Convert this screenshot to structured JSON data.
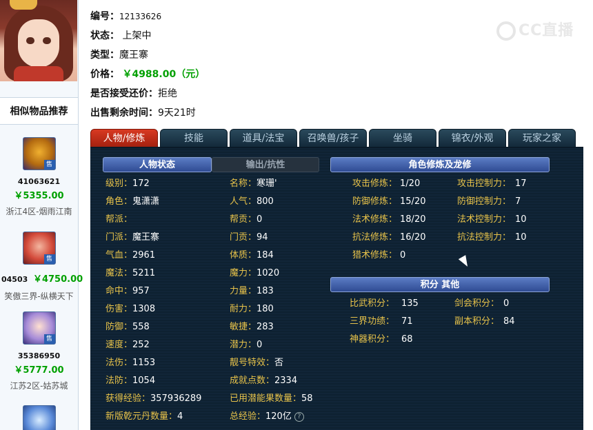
{
  "item": {
    "id_label": "编号：",
    "id": "12133626",
    "status_label": "状态：",
    "status": "上架中",
    "type_label": "类型：",
    "type": "魔王寨",
    "price_label": "价格：",
    "price": "￥4988.00（元）",
    "bargain_label": "是否接受还价：",
    "bargain": "拒绝",
    "remaining_label": "出售剩余时间：",
    "remaining": "9天21时"
  },
  "watermark": "CC直播",
  "sidebar": {
    "similar_title": "相似物品推荐",
    "recommendations": [
      {
        "id": "41063621",
        "price": "￥5355.00",
        "server": "浙江4区-烟雨江南",
        "badge": "售"
      },
      {
        "id": "04503",
        "price": "￥4750.00",
        "server": "笑傲三界-纵横天下",
        "badge": "售"
      },
      {
        "id": "35386950",
        "price": "￥5777.00",
        "server": "江苏2区-姑苏城",
        "badge": "售"
      }
    ]
  },
  "tabs": [
    "人物/修炼",
    "技能",
    "道具/法宝",
    "召唤兽/孩子",
    "坐骑",
    "锦衣/外观",
    "玩家之家"
  ],
  "panel": {
    "status_tab": "人物状态",
    "output_tab": "输出/抗性",
    "cultivation_title": "角色修炼及龙修",
    "score_title": "积分 其他",
    "left_col": [
      {
        "k": "级别：",
        "v": "172"
      },
      {
        "k": "角色：",
        "v": "鬼潇潇"
      },
      {
        "k": "帮派：",
        "v": ""
      },
      {
        "k": "门派：",
        "v": "魔王寨"
      },
      {
        "k": "气血：",
        "v": "2961"
      },
      {
        "k": "魔法：",
        "v": "5211"
      },
      {
        "k": "命中：",
        "v": "957"
      },
      {
        "k": "伤害：",
        "v": "1308"
      },
      {
        "k": "防御：",
        "v": "558"
      },
      {
        "k": "速度：",
        "v": "252"
      },
      {
        "k": "法伤：",
        "v": "1153"
      },
      {
        "k": "法防：",
        "v": "1054"
      },
      {
        "k": "获得经验：",
        "v": "357936289"
      },
      {
        "k": "新版乾元丹数量：",
        "v": "4"
      }
    ],
    "mid_col": [
      {
        "k": "名称：",
        "v": "寒珊'"
      },
      {
        "k": "人气：",
        "v": "800"
      },
      {
        "k": "帮贡：",
        "v": "0"
      },
      {
        "k": "门贡：",
        "v": "94"
      },
      {
        "k": "体质：",
        "v": "184"
      },
      {
        "k": "魔力：",
        "v": "1020"
      },
      {
        "k": "力量：",
        "v": "183"
      },
      {
        "k": "耐力：",
        "v": "180"
      },
      {
        "k": "敏捷：",
        "v": "283"
      },
      {
        "k": "潜力：",
        "v": "0"
      },
      {
        "k": "靓号特效：",
        "v": "否"
      },
      {
        "k": "成就点数：",
        "v": "2334"
      },
      {
        "k": "已用潜能果数量：",
        "v": "58"
      },
      {
        "k": "总经验：",
        "v": "120亿"
      }
    ],
    "cult_col1": [
      {
        "k": "攻击修炼：",
        "v": "1/20"
      },
      {
        "k": "防御修炼：",
        "v": "15/20"
      },
      {
        "k": "法术修炼：",
        "v": "18/20"
      },
      {
        "k": "抗法修炼：",
        "v": "16/20"
      },
      {
        "k": "猎术修炼：",
        "v": "0"
      }
    ],
    "cult_col2": [
      {
        "k": "攻击控制力：",
        "v": "17"
      },
      {
        "k": "防御控制力：",
        "v": "7"
      },
      {
        "k": "法术控制力：",
        "v": "10"
      },
      {
        "k": "抗法控制力：",
        "v": "10"
      }
    ],
    "score_col1": [
      {
        "k": "比武积分：",
        "v": "135"
      },
      {
        "k": "三界功绩：",
        "v": "71"
      },
      {
        "k": "神器积分：",
        "v": "68"
      }
    ],
    "score_col2": [
      {
        "k": "剑会积分：",
        "v": "0"
      },
      {
        "k": "副本积分：",
        "v": "84"
      }
    ],
    "help_icon": "?"
  },
  "colors": {
    "key": "#e8c34a",
    "value": "#ffffff",
    "price": "#00a000",
    "active_tab": "#c62d17"
  }
}
